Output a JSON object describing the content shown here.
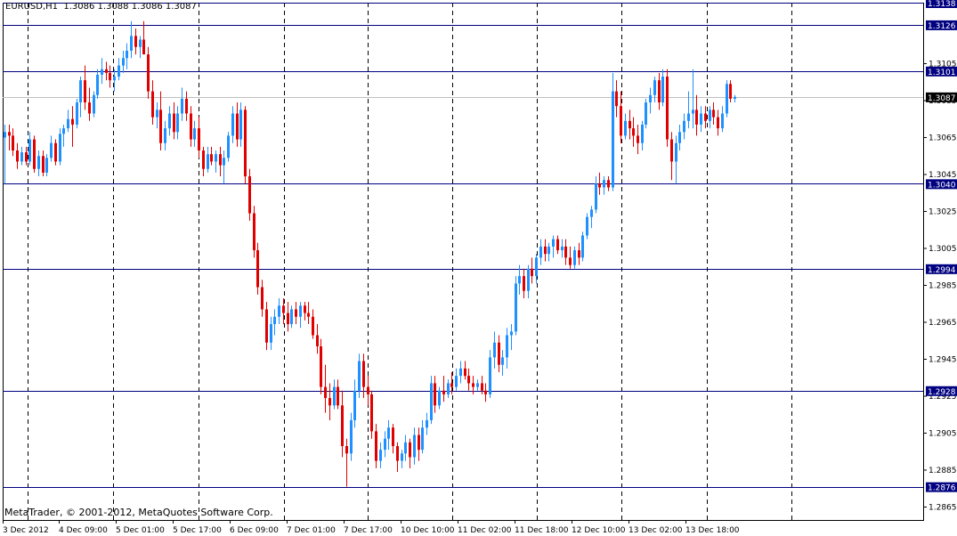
{
  "header": {
    "symbol": "EURUSD,H1",
    "ohlc": "1.3086 1.3088 1.3086 1.3087"
  },
  "footer": {
    "copyright": "MetaTrader, © 2001-2012, MetaQuotes Software Corp."
  },
  "colors": {
    "bull": "#1e90ff",
    "bear": "#e00000",
    "level_line": "#000080",
    "level_label_bg": "#000080",
    "current_price_line": "#c0c0c0",
    "current_price_label_bg": "#000000",
    "grid": "#000000"
  },
  "chart_data": {
    "type": "candlestick",
    "y_ticks": [
      "1.3105",
      "1.3085",
      "1.3065",
      "1.3045",
      "1.3025",
      "1.3005",
      "1.2985",
      "1.2965",
      "1.2945",
      "1.2925",
      "1.2905",
      "1.2885",
      "1.2865"
    ],
    "x_ticks": [
      "3 Dec 2012",
      "4 Dec 09:00",
      "5 Dec 01:00",
      "5 Dec 17:00",
      "6 Dec 09:00",
      "7 Dec 01:00",
      "7 Dec 17:00",
      "10 Dec 10:00",
      "11 Dec 02:00",
      "11 Dec 18:00",
      "12 Dec 10:00",
      "13 Dec 02:00",
      "13 Dec 18:00"
    ],
    "ylim": [
      1.2858,
      1.3138
    ],
    "levels": [
      "1.3138",
      "1.3126",
      "1.3101",
      "1.3040",
      "1.2994",
      "1.2928",
      "1.2876"
    ],
    "current_price": "1.3087",
    "grid": "vertical dashed",
    "candles": [
      [
        1.3065,
        1.3072,
        1.304,
        1.3068
      ],
      [
        1.3068,
        1.3072,
        1.3058,
        1.3066
      ],
      [
        1.3066,
        1.307,
        1.3055,
        1.3058
      ],
      [
        1.3058,
        1.3062,
        1.3048,
        1.3052
      ],
      [
        1.3052,
        1.306,
        1.305,
        1.3057
      ],
      [
        1.3057,
        1.306,
        1.305,
        1.3052
      ],
      [
        1.3052,
        1.3068,
        1.305,
        1.3064
      ],
      [
        1.3064,
        1.3066,
        1.3046,
        1.3048
      ],
      [
        1.3048,
        1.3058,
        1.3044,
        1.3055
      ],
      [
        1.3055,
        1.3058,
        1.3044,
        1.3046
      ],
      [
        1.3046,
        1.3056,
        1.3044,
        1.3054
      ],
      [
        1.3054,
        1.3066,
        1.3052,
        1.3062
      ],
      [
        1.3062,
        1.3064,
        1.305,
        1.3052
      ],
      [
        1.3052,
        1.307,
        1.305,
        1.3067
      ],
      [
        1.3067,
        1.3072,
        1.306,
        1.307
      ],
      [
        1.307,
        1.308,
        1.3068,
        1.3075
      ],
      [
        1.3075,
        1.3082,
        1.306,
        1.3072
      ],
      [
        1.3072,
        1.3086,
        1.307,
        1.3084
      ],
      [
        1.3084,
        1.3098,
        1.3076,
        1.3096
      ],
      [
        1.3096,
        1.3104,
        1.308,
        1.3084
      ],
      [
        1.3084,
        1.3092,
        1.3074,
        1.3078
      ],
      [
        1.3078,
        1.309,
        1.3076,
        1.3088
      ],
      [
        1.3088,
        1.3102,
        1.3086,
        1.3099
      ],
      [
        1.3099,
        1.3108,
        1.3094,
        1.3102
      ],
      [
        1.3102,
        1.3106,
        1.3096,
        1.31
      ],
      [
        1.31,
        1.3104,
        1.3092,
        1.3096
      ],
      [
        1.3096,
        1.3102,
        1.309,
        1.3098
      ],
      [
        1.3098,
        1.3108,
        1.3096,
        1.3104
      ],
      [
        1.3104,
        1.3112,
        1.31,
        1.3108
      ],
      [
        1.3108,
        1.3116,
        1.3102,
        1.3112
      ],
      [
        1.3112,
        1.3128,
        1.3108,
        1.312
      ],
      [
        1.312,
        1.3124,
        1.311,
        1.3114
      ],
      [
        1.3114,
        1.312,
        1.3108,
        1.3118
      ],
      [
        1.3118,
        1.3128,
        1.3114,
        1.311
      ],
      [
        1.311,
        1.3114,
        1.3086,
        1.309
      ],
      [
        1.309,
        1.3096,
        1.3072,
        1.3076
      ],
      [
        1.3076,
        1.3084,
        1.307,
        1.308
      ],
      [
        1.308,
        1.309,
        1.3058,
        1.3062
      ],
      [
        1.3062,
        1.3074,
        1.3058,
        1.307
      ],
      [
        1.307,
        1.3082,
        1.3066,
        1.3078
      ],
      [
        1.3078,
        1.3084,
        1.3064,
        1.3068
      ],
      [
        1.3068,
        1.3082,
        1.3064,
        1.3078
      ],
      [
        1.3078,
        1.3092,
        1.3074,
        1.3086
      ],
      [
        1.3086,
        1.309,
        1.3074,
        1.3078
      ],
      [
        1.3078,
        1.3082,
        1.306,
        1.3064
      ],
      [
        1.3064,
        1.3074,
        1.306,
        1.307
      ],
      [
        1.307,
        1.3076,
        1.3054,
        1.3058
      ],
      [
        1.3058,
        1.306,
        1.3044,
        1.3048
      ],
      [
        1.3048,
        1.306,
        1.3046,
        1.3056
      ],
      [
        1.3056,
        1.306,
        1.305,
        1.3052
      ],
      [
        1.3052,
        1.3058,
        1.3046,
        1.3056
      ],
      [
        1.3056,
        1.306,
        1.3044,
        1.305
      ],
      [
        1.305,
        1.3058,
        1.304,
        1.3054
      ],
      [
        1.3054,
        1.3068,
        1.3052,
        1.3066
      ],
      [
        1.3066,
        1.3082,
        1.3062,
        1.3078
      ],
      [
        1.3078,
        1.3084,
        1.306,
        1.3064
      ],
      [
        1.3064,
        1.3084,
        1.306,
        1.308
      ],
      [
        1.308,
        1.3082,
        1.304,
        1.3044
      ],
      [
        1.3044,
        1.3048,
        1.302,
        1.3024
      ],
      [
        1.3024,
        1.3028,
        1.3,
        1.3004
      ],
      [
        1.3004,
        1.3008,
        1.298,
        1.2984
      ],
      [
        1.2984,
        1.2988,
        1.2968,
        1.2972
      ],
      [
        1.2972,
        1.2976,
        1.295,
        1.2954
      ],
      [
        1.2954,
        1.2968,
        1.295,
        1.2964
      ],
      [
        1.2964,
        1.2972,
        1.2958,
        1.2968
      ],
      [
        1.2968,
        1.2978,
        1.2964,
        1.2974
      ],
      [
        1.2974,
        1.2978,
        1.2964,
        1.297
      ],
      [
        1.297,
        1.2976,
        1.296,
        1.2964
      ],
      [
        1.2964,
        1.2974,
        1.2962,
        1.2972
      ],
      [
        1.2972,
        1.2976,
        1.2964,
        1.2968
      ],
      [
        1.2968,
        1.2976,
        1.2962,
        1.2974
      ],
      [
        1.2974,
        1.2976,
        1.2966,
        1.297
      ],
      [
        1.297,
        1.2976,
        1.2964,
        1.2968
      ],
      [
        1.2968,
        1.2972,
        1.2956,
        1.2958
      ],
      [
        1.2958,
        1.2964,
        1.2948,
        1.2952
      ],
      [
        1.2952,
        1.2956,
        1.2926,
        1.293
      ],
      [
        1.293,
        1.2942,
        1.2916,
        1.2924
      ],
      [
        1.2924,
        1.2932,
        1.2912,
        1.292
      ],
      [
        1.292,
        1.2934,
        1.2918,
        1.293
      ],
      [
        1.293,
        1.2934,
        1.2918,
        1.292
      ],
      [
        1.292,
        1.2928,
        1.2892,
        1.2898
      ],
      [
        1.2898,
        1.2902,
        1.2876,
        1.2894
      ],
      [
        1.2894,
        1.2916,
        1.289,
        1.2912
      ],
      [
        1.2912,
        1.2934,
        1.2908,
        1.2928
      ],
      [
        1.2928,
        1.2948,
        1.2924,
        1.2944
      ],
      [
        1.2944,
        1.2948,
        1.2924,
        1.293
      ],
      [
        1.293,
        1.2936,
        1.292,
        1.2926
      ],
      [
        1.2926,
        1.2928,
        1.2902,
        1.2906
      ],
      [
        1.2906,
        1.291,
        1.2886,
        1.289
      ],
      [
        1.289,
        1.29,
        1.2886,
        1.2896
      ],
      [
        1.2896,
        1.2906,
        1.2892,
        1.2902
      ],
      [
        1.2902,
        1.2912,
        1.2896,
        1.2908
      ],
      [
        1.2908,
        1.291,
        1.2894,
        1.2898
      ],
      [
        1.2898,
        1.29,
        1.2884,
        1.289
      ],
      [
        1.289,
        1.2896,
        1.2886,
        1.2894
      ],
      [
        1.2894,
        1.2904,
        1.289,
        1.29
      ],
      [
        1.29,
        1.2902,
        1.2886,
        1.2892
      ],
      [
        1.2892,
        1.2908,
        1.2888,
        1.2904
      ],
      [
        1.2904,
        1.2908,
        1.289,
        1.2896
      ],
      [
        1.2896,
        1.2912,
        1.2894,
        1.2908
      ],
      [
        1.2908,
        1.2916,
        1.2904,
        1.2912
      ],
      [
        1.2912,
        1.2936,
        1.291,
        1.2932
      ],
      [
        1.2932,
        1.2936,
        1.2916,
        1.292
      ],
      [
        1.292,
        1.293,
        1.2918,
        1.2928
      ],
      [
        1.2928,
        1.2936,
        1.2922,
        1.2926
      ],
      [
        1.2926,
        1.2934,
        1.2924,
        1.2932
      ],
      [
        1.2932,
        1.2938,
        1.2926,
        1.293
      ],
      [
        1.293,
        1.294,
        1.2928,
        1.2936
      ],
      [
        1.2936,
        1.2944,
        1.2932,
        1.294
      ],
      [
        1.294,
        1.2944,
        1.2934,
        1.2936
      ],
      [
        1.2936,
        1.294,
        1.2928,
        1.2932
      ],
      [
        1.2932,
        1.2936,
        1.2926,
        1.293
      ],
      [
        1.293,
        1.2934,
        1.2928,
        1.2932
      ],
      [
        1.2932,
        1.2936,
        1.2926,
        1.2928
      ],
      [
        1.2928,
        1.2932,
        1.2922,
        1.2926
      ],
      [
        1.2926,
        1.295,
        1.2924,
        1.2946
      ],
      [
        1.2946,
        1.296,
        1.294,
        1.2954
      ],
      [
        1.2954,
        1.2958,
        1.2938,
        1.2942
      ],
      [
        1.2942,
        1.295,
        1.2936,
        1.2946
      ],
      [
        1.2946,
        1.2962,
        1.294,
        1.2958
      ],
      [
        1.2958,
        1.2964,
        1.295,
        1.296
      ],
      [
        1.296,
        1.299,
        1.2958,
        1.2986
      ],
      [
        1.2986,
        1.2996,
        1.298,
        1.299
      ],
      [
        1.299,
        1.2994,
        1.2978,
        1.2982
      ],
      [
        1.2982,
        1.2996,
        1.2978,
        1.2994
      ],
      [
        1.2994,
        1.3,
        1.2986,
        1.299
      ],
      [
        1.299,
        1.3002,
        1.2986,
        1.3
      ],
      [
        1.3,
        1.301,
        1.2996,
        1.3006
      ],
      [
        1.3006,
        1.301,
        1.2998,
        1.3002
      ],
      [
        1.3002,
        1.3008,
        1.2998,
        1.3006
      ],
      [
        1.3006,
        1.3012,
        1.3,
        1.301
      ],
      [
        1.301,
        1.3012,
        1.3002,
        1.3004
      ],
      [
        1.3004,
        1.301,
        1.3,
        1.3006
      ],
      [
        1.3006,
        1.301,
        1.2996,
        1.3
      ],
      [
        1.3,
        1.3006,
        1.2994,
        1.2996
      ],
      [
        1.2996,
        1.3006,
        1.2994,
        1.3004
      ],
      [
        1.3004,
        1.3008,
        1.2996,
        1.3
      ],
      [
        1.3,
        1.3014,
        1.2998,
        1.3012
      ],
      [
        1.3012,
        1.3024,
        1.301,
        1.3022
      ],
      [
        1.3022,
        1.3028,
        1.3016,
        1.3026
      ],
      [
        1.3026,
        1.3044,
        1.3024,
        1.304
      ],
      [
        1.304,
        1.3046,
        1.3034,
        1.3038
      ],
      [
        1.3038,
        1.3044,
        1.3034,
        1.3042
      ],
      [
        1.3042,
        1.3044,
        1.3036,
        1.3038
      ],
      [
        1.3038,
        1.31,
        1.3036,
        1.309
      ],
      [
        1.309,
        1.3096,
        1.3076,
        1.3082
      ],
      [
        1.3082,
        1.309,
        1.3062,
        1.3066
      ],
      [
        1.3066,
        1.3078,
        1.3064,
        1.3074
      ],
      [
        1.3074,
        1.308,
        1.3064,
        1.307
      ],
      [
        1.307,
        1.3076,
        1.306,
        1.3066
      ],
      [
        1.3066,
        1.3072,
        1.3056,
        1.3062
      ],
      [
        1.3062,
        1.3074,
        1.3058,
        1.3072
      ],
      [
        1.3072,
        1.3086,
        1.307,
        1.3084
      ],
      [
        1.3084,
        1.3092,
        1.3078,
        1.3088
      ],
      [
        1.3088,
        1.3098,
        1.3084,
        1.3096
      ],
      [
        1.3096,
        1.31,
        1.308,
        1.3084
      ],
      [
        1.3084,
        1.3102,
        1.3082,
        1.3098
      ],
      [
        1.3098,
        1.3102,
        1.306,
        1.3064
      ],
      [
        1.3064,
        1.3068,
        1.3042,
        1.3052
      ],
      [
        1.3052,
        1.3066,
        1.304,
        1.3062
      ],
      [
        1.3062,
        1.3072,
        1.3058,
        1.3068
      ],
      [
        1.3068,
        1.3078,
        1.3064,
        1.3074
      ],
      [
        1.3074,
        1.309,
        1.307,
        1.3078
      ],
      [
        1.3078,
        1.3102,
        1.307,
        1.308
      ],
      [
        1.308,
        1.3088,
        1.3066,
        1.3072
      ],
      [
        1.3072,
        1.3082,
        1.3068,
        1.3078
      ],
      [
        1.3078,
        1.3082,
        1.307,
        1.3074
      ],
      [
        1.3074,
        1.3082,
        1.307,
        1.308
      ],
      [
        1.308,
        1.3084,
        1.3072,
        1.3076
      ],
      [
        1.3076,
        1.308,
        1.3066,
        1.307
      ],
      [
        1.307,
        1.3082,
        1.3068,
        1.3078
      ],
      [
        1.3078,
        1.3096,
        1.3076,
        1.3094
      ],
      [
        1.3094,
        1.3096,
        1.3084,
        1.3086
      ],
      [
        1.3086,
        1.3088,
        1.3084,
        1.3087
      ]
    ]
  }
}
